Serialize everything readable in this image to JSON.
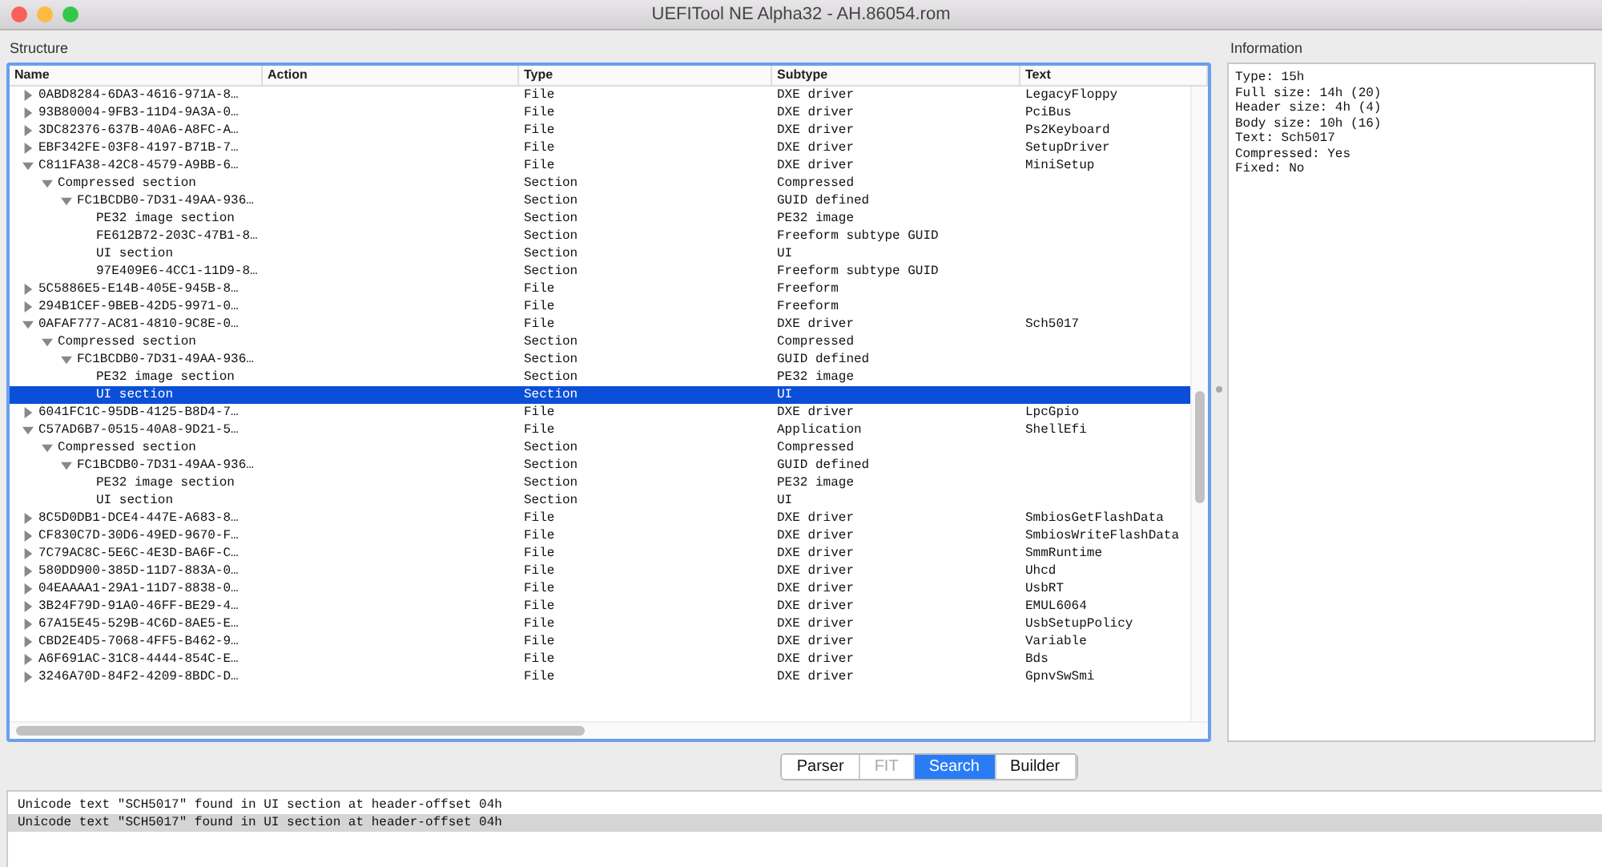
{
  "window": {
    "title": "UEFITool NE Alpha32 - AH.86054.rom"
  },
  "structure": {
    "label": "Structure",
    "columns": [
      "Name",
      "Action",
      "Type",
      "Subtype",
      "Text"
    ],
    "rows": [
      {
        "name": "0ABD8284-6DA3-4616-971A-8…",
        "type": "File",
        "subtype": "DXE driver",
        "text": "LegacyFloppy",
        "expanded": false,
        "selected": false
      },
      {
        "name": "93B80004-9FB3-11D4-9A3A-0…",
        "type": "File",
        "subtype": "DXE driver",
        "text": "PciBus",
        "expanded": false,
        "selected": false
      },
      {
        "name": "3DC82376-637B-40A6-A8FC-A…",
        "type": "File",
        "subtype": "DXE driver",
        "text": "Ps2Keyboard",
        "expanded": false,
        "selected": false
      },
      {
        "name": "EBF342FE-03F8-4197-B71B-7…",
        "type": "File",
        "subtype": "DXE driver",
        "text": "SetupDriver",
        "expanded": false,
        "selected": false
      },
      {
        "name": "C811FA38-42C8-4579-A9BB-6…",
        "type": "File",
        "subtype": "DXE driver",
        "text": "MiniSetup",
        "expanded": true,
        "selected": false,
        "children": [
          {
            "name": "Compressed section",
            "type": "Section",
            "subtype": "Compressed",
            "expanded": true,
            "selected": false,
            "children": [
              {
                "name": "FC1BCDB0-7D31-49AA-936…",
                "type": "Section",
                "subtype": "GUID defined",
                "expanded": true,
                "selected": false,
                "children": [
                  {
                    "name": "PE32 image section",
                    "type": "Section",
                    "subtype": "PE32 image",
                    "selected": false
                  },
                  {
                    "name": "FE612B72-203C-47B1-8…",
                    "type": "Section",
                    "subtype": "Freeform subtype GUID",
                    "selected": false
                  },
                  {
                    "name": "UI section",
                    "type": "Section",
                    "subtype": "UI",
                    "selected": false
                  },
                  {
                    "name": "97E409E6-4CC1-11D9-8…",
                    "type": "Section",
                    "subtype": "Freeform subtype GUID",
                    "selected": false
                  }
                ]
              }
            ]
          }
        ]
      },
      {
        "name": "5C5886E5-E14B-405E-945B-8…",
        "type": "File",
        "subtype": "Freeform",
        "expanded": false,
        "selected": false
      },
      {
        "name": "294B1CEF-9BEB-42D5-9971-0…",
        "type": "File",
        "subtype": "Freeform",
        "expanded": false,
        "selected": false
      },
      {
        "name": "0AFAF777-AC81-4810-9C8E-0…",
        "type": "File",
        "subtype": "DXE driver",
        "text": "Sch5017",
        "expanded": true,
        "selected": false,
        "children": [
          {
            "name": "Compressed section",
            "type": "Section",
            "subtype": "Compressed",
            "expanded": true,
            "selected": false,
            "children": [
              {
                "name": "FC1BCDB0-7D31-49AA-936…",
                "type": "Section",
                "subtype": "GUID defined",
                "expanded": true,
                "selected": false,
                "children": [
                  {
                    "name": "PE32 image section",
                    "type": "Section",
                    "subtype": "PE32 image",
                    "selected": false
                  },
                  {
                    "name": "UI section",
                    "type": "Section",
                    "subtype": "UI",
                    "selected": true
                  }
                ]
              }
            ]
          }
        ]
      },
      {
        "name": "6041FC1C-95DB-4125-B8D4-7…",
        "type": "File",
        "subtype": "DXE driver",
        "text": "LpcGpio",
        "expanded": false,
        "selected": false
      },
      {
        "name": "C57AD6B7-0515-40A8-9D21-5…",
        "type": "File",
        "subtype": "Application",
        "text": "ShellEfi",
        "expanded": true,
        "selected": false,
        "children": [
          {
            "name": "Compressed section",
            "type": "Section",
            "subtype": "Compressed",
            "expanded": true,
            "selected": false,
            "children": [
              {
                "name": "FC1BCDB0-7D31-49AA-936…",
                "type": "Section",
                "subtype": "GUID defined",
                "expanded": true,
                "selected": false,
                "children": [
                  {
                    "name": "PE32 image section",
                    "type": "Section",
                    "subtype": "PE32 image",
                    "selected": false
                  },
                  {
                    "name": "UI section",
                    "type": "Section",
                    "subtype": "UI",
                    "selected": false
                  }
                ]
              }
            ]
          }
        ]
      },
      {
        "name": "8C5D0DB1-DCE4-447E-A683-8…",
        "type": "File",
        "subtype": "DXE driver",
        "text": "SmbiosGetFlashData",
        "expanded": false,
        "selected": false
      },
      {
        "name": "CF830C7D-30D6-49ED-9670-F…",
        "type": "File",
        "subtype": "DXE driver",
        "text": "SmbiosWriteFlashData",
        "expanded": false,
        "selected": false
      },
      {
        "name": "7C79AC8C-5E6C-4E3D-BA6F-C…",
        "type": "File",
        "subtype": "DXE driver",
        "text": "SmmRuntime",
        "expanded": false,
        "selected": false
      },
      {
        "name": "580DD900-385D-11D7-883A-0…",
        "type": "File",
        "subtype": "DXE driver",
        "text": "Uhcd",
        "expanded": false,
        "selected": false
      },
      {
        "name": "04EAAAA1-29A1-11D7-8838-0…",
        "type": "File",
        "subtype": "DXE driver",
        "text": "UsbRT",
        "expanded": false,
        "selected": false
      },
      {
        "name": "3B24F79D-91A0-46FF-BE29-4…",
        "type": "File",
        "subtype": "DXE driver",
        "text": "EMUL6064",
        "expanded": false,
        "selected": false
      },
      {
        "name": "67A15E45-529B-4C6D-8AE5-E…",
        "type": "File",
        "subtype": "DXE driver",
        "text": "UsbSetupPolicy",
        "expanded": false,
        "selected": false
      },
      {
        "name": "CBD2E4D5-7068-4FF5-B462-9…",
        "type": "File",
        "subtype": "DXE driver",
        "text": "Variable",
        "expanded": false,
        "selected": false
      },
      {
        "name": "A6F691AC-31C8-4444-854C-E…",
        "type": "File",
        "subtype": "DXE driver",
        "text": "Bds",
        "expanded": false,
        "selected": false
      },
      {
        "name": "3246A70D-84F2-4209-8BDC-D…",
        "type": "File",
        "subtype": "DXE driver",
        "text": "GpnvSwSmi",
        "expanded": false,
        "selected": false
      }
    ]
  },
  "information": {
    "label": "Information",
    "lines": [
      "Type: 15h",
      "Full size: 14h (20)",
      "Header size: 4h (4)",
      "Body size: 10h (16)",
      "Text: Sch5017",
      "Compressed: Yes",
      "Fixed: No"
    ]
  },
  "tabs": [
    {
      "label": "Parser",
      "selected": false,
      "disabled": false
    },
    {
      "label": "FIT",
      "selected": false,
      "disabled": true
    },
    {
      "label": "Search",
      "selected": true,
      "disabled": false
    },
    {
      "label": "Builder",
      "selected": false,
      "disabled": false
    }
  ],
  "messages": [
    {
      "text": "Unicode text \"SCH5017\" found in UI section at header-offset 04h",
      "selected": false
    },
    {
      "text": "Unicode text \"SCH5017\" found in UI section at header-offset 04h",
      "selected": true
    }
  ]
}
